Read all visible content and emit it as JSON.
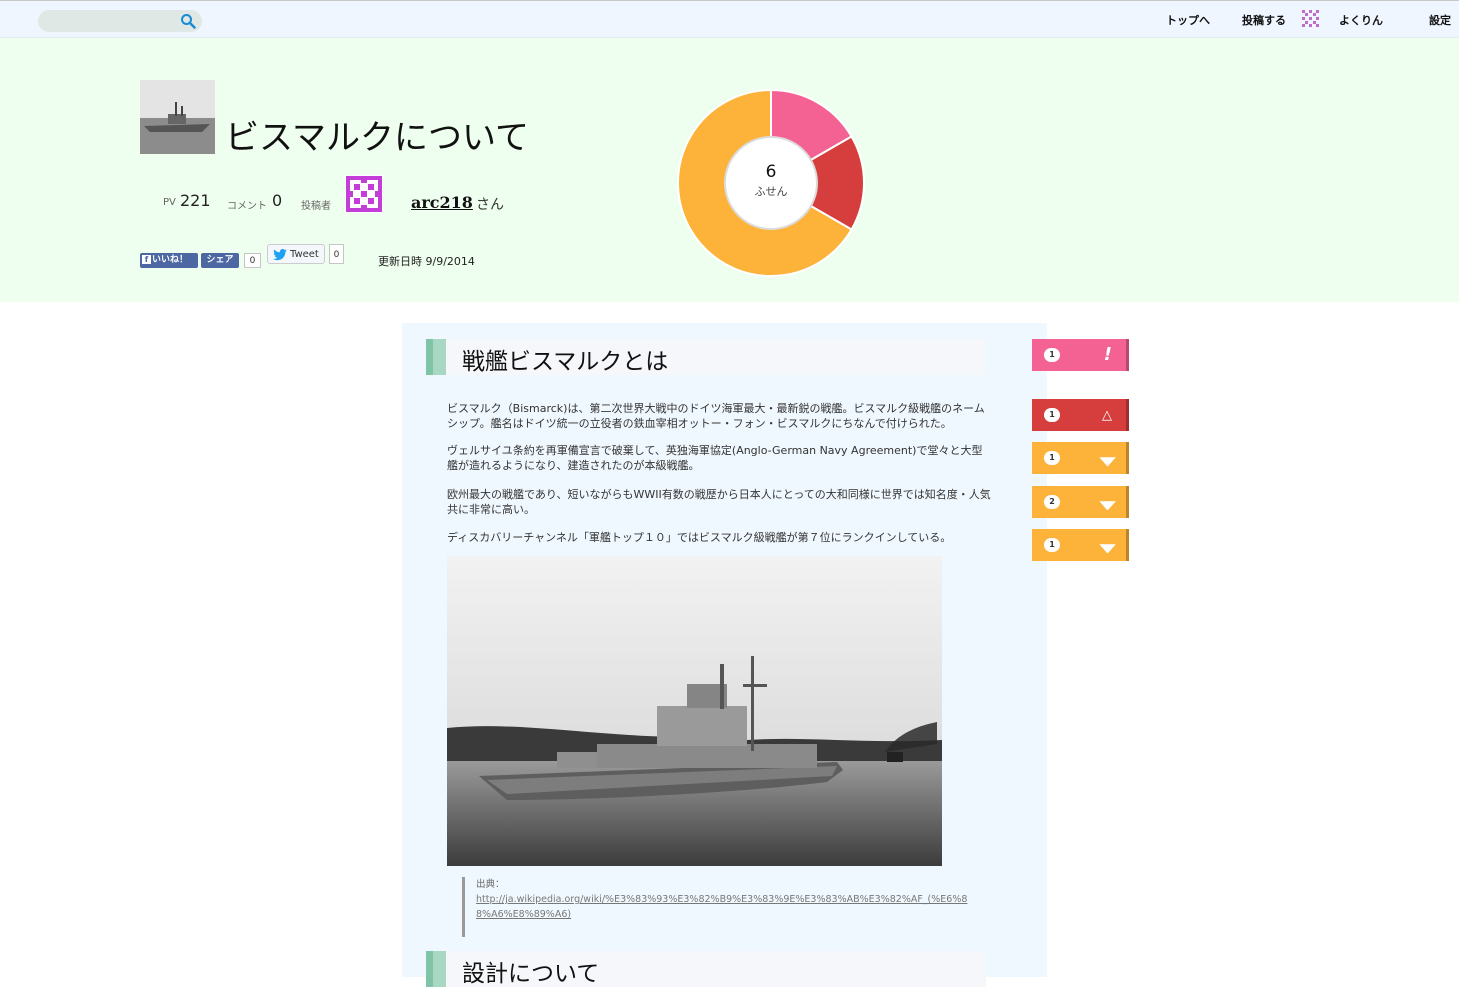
{
  "topbar": {
    "search_placeholder": "",
    "nav": {
      "top": "トップへ",
      "post": "投稿する",
      "yokurin": "よくりん",
      "settings": "設定"
    }
  },
  "header": {
    "title": "ビスマルクについて",
    "pv_label": "PV",
    "pv_value": "221",
    "comment_label": "コメント",
    "comment_value": "0",
    "poster_label": "投稿者",
    "author": "arc218",
    "author_suffix": "さん",
    "fb_like": "いいね！",
    "fb_share": "シェア",
    "fb_count": "0",
    "tweet_label": "Tweet",
    "tweet_count": "0",
    "updated": "更新日時 9/9/2014"
  },
  "donut": {
    "center_value": "6",
    "center_label": "ふせん",
    "segments": [
      {
        "color": "#f46293",
        "value": 1
      },
      {
        "color": "#d63d3d",
        "value": 1
      },
      {
        "color": "#fdb23a",
        "value": 4
      }
    ]
  },
  "content": {
    "heading1": "戦艦ビスマルクとは",
    "paragraphs": [
      "ビスマルク（Bismarck)は、第二次世界大戦中のドイツ海軍最大・最新鋭の戦艦。ビスマルク級戦艦のネームシップ。艦名はドイツ統一の立役者の鉄血宰相オットー・フォン・ビスマルクにちなんで付けられた。",
      "ヴェルサイユ条約を再軍備宣言で破棄して、英独海軍協定(Anglo-German Navy Agreement)で堂々と大型艦が造れるようになり、建造されたのが本級戦艦。",
      "欧州最大の戦艦であり、短いながらもWWII有数の戦歴から日本人にとっての大和同様に世界では知名度・人気共に非常に高い。",
      "ディスカバリーチャンネル「軍艦トップ１０」ではビスマルク級戦艦が第７位にランクインしている。"
    ],
    "cite_label": "出典：",
    "cite_url": "http://ja.wikipedia.org/wiki/%E3%83%93%E3%82%B9%E3%83%9E%E3%83%AB%E3%82%AF_(%E6%88%A6%E8%89%A6)",
    "heading2": "設計について"
  },
  "notes": [
    {
      "count": "1",
      "icon": "!",
      "color": "#f46293"
    },
    {
      "count": "1",
      "icon": "△",
      "color": "#d63d3d"
    },
    {
      "count": "1",
      "icon": "▼",
      "color": "#fdb23a"
    },
    {
      "count": "2",
      "icon": "▼",
      "color": "#fdb23a"
    },
    {
      "count": "1",
      "icon": "▼",
      "color": "#fdb23a"
    }
  ]
}
